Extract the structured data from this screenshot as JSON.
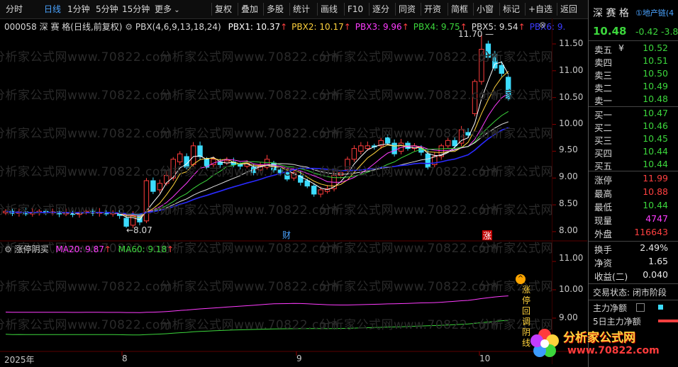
{
  "toolbar": {
    "items": [
      "分时",
      "日线",
      "1分钟",
      "5分钟",
      "15分钟",
      "更多",
      "复权",
      "叠加",
      "多股",
      "统计",
      "画线",
      "F10",
      "逐分",
      "同资",
      "开资",
      "简框",
      "小窗",
      "标记",
      "+自选",
      "返回"
    ],
    "active_index": 1
  },
  "main_chart": {
    "code": "000058",
    "name": "深 赛 格",
    "period_label": "(日线,前复权)",
    "indicator": "PBX(4,6,9,13,18,24)",
    "pbx": [
      {
        "label": "PBX1: 10.37",
        "color": "#ffffff"
      },
      {
        "label": "PBX2: 10.17",
        "color": "#ffd23c"
      },
      {
        "label": "PBX3: 9.96",
        "color": "#ff3cff"
      },
      {
        "label": "PBX4: 9.75",
        "color": "#3cd63c"
      },
      {
        "label": "PBX5: 9.54",
        "color": "#e0e0e0"
      },
      {
        "label": "PBX6: 9.",
        "color": "#3c3cff"
      }
    ],
    "y_ticks": [
      "11.50",
      "11.00",
      "10.50",
      "10.00",
      "9.50",
      "9.00",
      "8.50",
      "8.00"
    ],
    "high_label": "11.70",
    "low_label": "8.07",
    "marker_cai": "财",
    "marker_zhang": "涨"
  },
  "sub_chart": {
    "title": "涨停阴买",
    "ma20": "MA20: 9.87",
    "ma60": "MA60: 9.18",
    "y_ticks": [
      "11.00",
      "10.00",
      "9.00"
    ],
    "signal_text": [
      "涨",
      "停",
      "回",
      "调",
      "阴",
      "线"
    ]
  },
  "x_axis": {
    "labels": [
      "2025年",
      "8",
      "9",
      "10"
    ]
  },
  "watermark": {
    "text": "分析家公式网www.70822.com"
  },
  "right_panel": {
    "name": "深 赛 格",
    "tag": "①地产链(4",
    "price": "10.48",
    "change": "-0.42",
    "change_pct": "-3.8",
    "asks": [
      {
        "label": "卖五",
        "value": "10.52",
        "mark": "¥"
      },
      {
        "label": "卖四",
        "value": "10.51"
      },
      {
        "label": "卖三",
        "value": "10.50"
      },
      {
        "label": "卖二",
        "value": "10.49"
      },
      {
        "label": "卖一",
        "value": "10.48"
      }
    ],
    "bids": [
      {
        "label": "买一",
        "value": "10.47"
      },
      {
        "label": "买二",
        "value": "10.46"
      },
      {
        "label": "买三",
        "value": "10.45"
      },
      {
        "label": "买四",
        "value": "10.44"
      },
      {
        "label": "买五",
        "value": "10.44"
      }
    ],
    "stats": [
      {
        "label": "涨停",
        "value": "11.99",
        "color": "#ff4040"
      },
      {
        "label": "最高",
        "value": "10.88",
        "color": "#ff4040"
      },
      {
        "label": "最低",
        "value": "10.44",
        "color": "#3cd63c"
      },
      {
        "label": "现量",
        "value": "4747",
        "color": "#ff3cff"
      },
      {
        "label": "外盘",
        "value": "116643",
        "color": "#ff4040"
      }
    ],
    "stats2": [
      {
        "label": "换手",
        "value": "2.49%"
      },
      {
        "label": "净资",
        "value": "1.65"
      },
      {
        "label": "收益(二)",
        "value": "0.040"
      }
    ],
    "status_label": "交易状态: 闭市阶段",
    "net_main": "主力净额",
    "net_5day": "5日主力净额"
  },
  "brand": {
    "name": "分析家公式网",
    "url": "www.70822.com"
  }
}
